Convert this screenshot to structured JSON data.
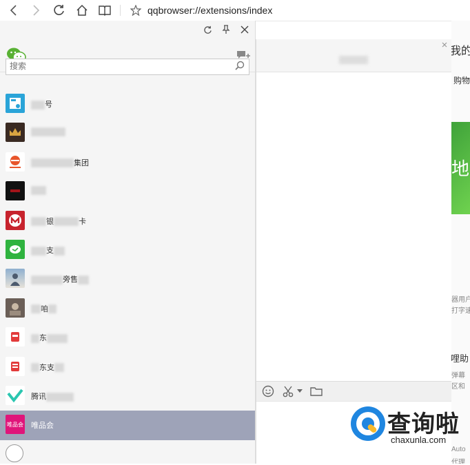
{
  "browser": {
    "url": "qqbrowser://extensions/index"
  },
  "wechat": {
    "search": {
      "placeholder": "搜索"
    },
    "contacts": [
      {
        "name": "号",
        "avatar_color": "#2aa4d8",
        "active": false
      },
      {
        "name": "",
        "avatar_color": "#3a2a22",
        "active": false
      },
      {
        "name": "集团",
        "avatar_color": "#ffffff",
        "active": false
      },
      {
        "name": "",
        "avatar_color": "#111111",
        "active": false
      },
      {
        "name": "银",
        "name2": "卡",
        "avatar_color": "#c7232d",
        "active": false
      },
      {
        "name": "支",
        "avatar_color": "#2fb33f",
        "active": false
      },
      {
        "name": "旁售",
        "avatar_color": "#7a8fa8",
        "active": false
      },
      {
        "name": "咱",
        "avatar_color": "#6b5f57",
        "active": false
      },
      {
        "name": "东",
        "avatar_color": "#ffffff",
        "active": false
      },
      {
        "name": "东支",
        "avatar_color": "#ffffff",
        "active": false
      },
      {
        "name": "腾讯",
        "avatar_color": "#ffffff",
        "active": false
      },
      {
        "name": "唯品会",
        "avatar_label": "唯品会",
        "avatar_color": "#e0157a",
        "active": true
      }
    ]
  },
  "page": {
    "texts": [
      "我的",
      "购物",
      "地",
      "器用户",
      "打字速",
      "哩助",
      "弹幕",
      "区和",
      "Auto",
      "代理"
    ]
  },
  "watermark": {
    "title": "查询啦",
    "subtitle": "chaxunla.com"
  },
  "colors": {
    "selected_row": "#9ea3b8",
    "brand_blue": "#1f86e0",
    "green_banner": "#3fa23a"
  }
}
